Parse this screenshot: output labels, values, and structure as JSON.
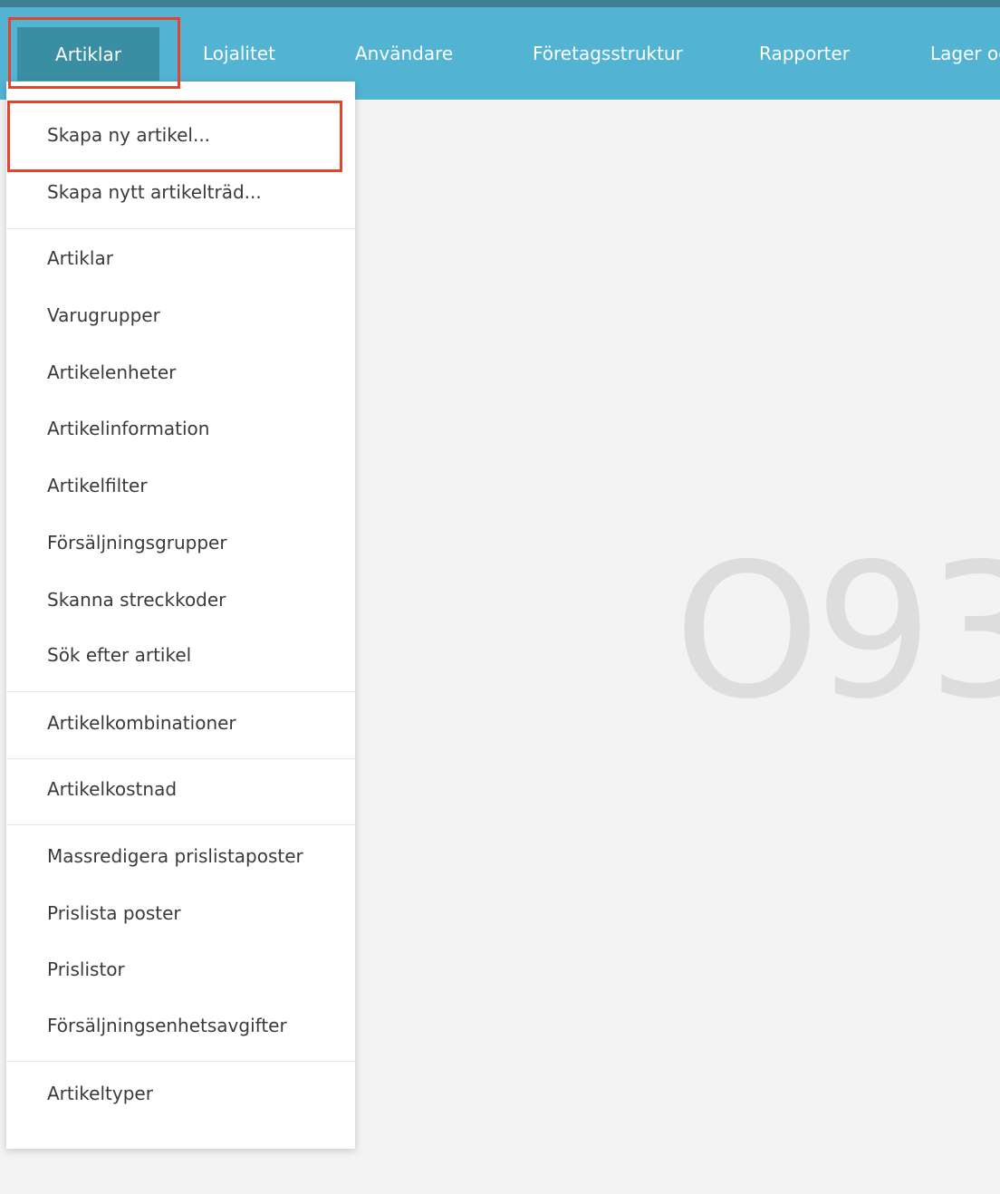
{
  "nav": {
    "tabs": [
      {
        "label": "Artiklar"
      },
      {
        "label": "Lojalitet"
      },
      {
        "label": "Användare"
      },
      {
        "label": "Företagsstruktur"
      },
      {
        "label": "Rapporter"
      },
      {
        "label": "Lager oc"
      }
    ]
  },
  "dropdown": {
    "items": [
      {
        "label": "Skapa ny artikel..."
      },
      {
        "label": "Skapa nytt artikelträd..."
      },
      {
        "label": "Artiklar"
      },
      {
        "label": "Varugrupper"
      },
      {
        "label": "Artikelenheter"
      },
      {
        "label": "Artikelinformation"
      },
      {
        "label": "Artikelfilter"
      },
      {
        "label": "Försäljningsgrupper"
      },
      {
        "label": "Skanna streckkoder"
      },
      {
        "label": "Sök efter artikel"
      },
      {
        "label": "Artikelkombinationer"
      },
      {
        "label": "Artikelkostnad"
      },
      {
        "label": "Massredigera prislistaposter"
      },
      {
        "label": "Prislista poster"
      },
      {
        "label": "Prislistor"
      },
      {
        "label": "Försäljningsenhetsavgifter"
      },
      {
        "label": "Artikeltyper"
      }
    ]
  },
  "watermark": {
    "text": "O93"
  },
  "colors": {
    "navbar": "#52b3d3",
    "active_tab": "#3a8ea1",
    "highlight": "#e3452a"
  }
}
